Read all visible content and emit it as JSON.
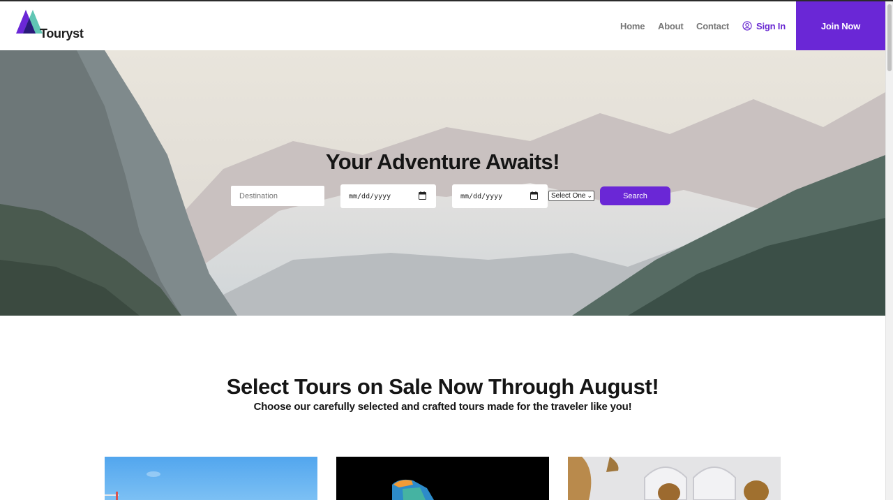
{
  "header": {
    "logo_text": "Touryst",
    "nav": {
      "home": "Home",
      "about": "About",
      "contact": "Contact",
      "sign_in": "Sign In",
      "join": "Join Now"
    }
  },
  "hero": {
    "title": "Your Adventure Awaits!",
    "destination_placeholder": "Destination",
    "date_start": "mm/dd/yyyy",
    "date_end": "mm/dd/yyyy",
    "select_value": "Select One",
    "search_label": "Search"
  },
  "sale": {
    "title": "Select Tours on Sale Now Through August!",
    "subtitle": "Choose our carefully selected and crafted tours made for the traveler like you!"
  },
  "colors": {
    "accent": "#6a27d6",
    "logo_teal": "#58c3b0",
    "logo_purple": "#6a27d6",
    "logo_navy": "#2a1a7a"
  },
  "icons": {
    "sign_in": "user-circle-icon",
    "calendar": "calendar-icon"
  }
}
